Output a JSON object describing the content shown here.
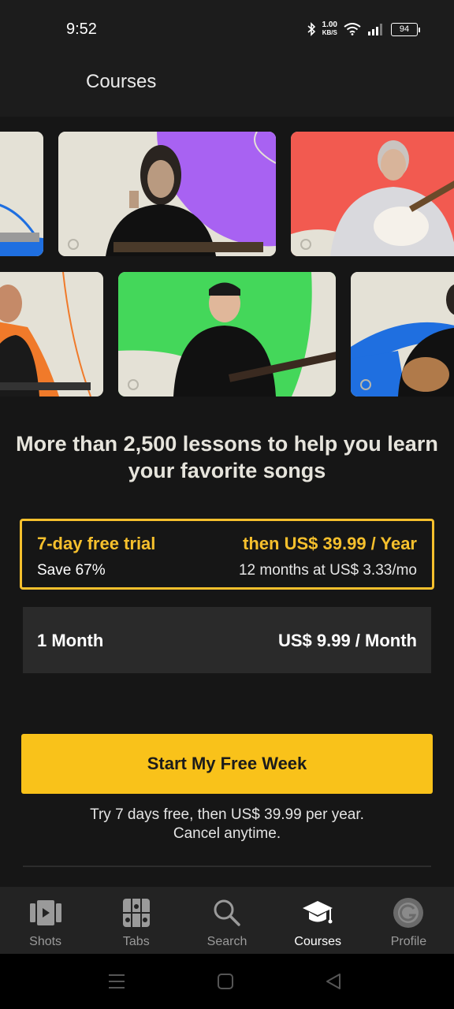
{
  "status_bar": {
    "time": "9:52",
    "speed_value": "1.00",
    "speed_unit": "KB/S",
    "battery": "94"
  },
  "header": {
    "title": "Courses"
  },
  "carousel": {
    "row1": [
      {
        "accent": "#1f6fe0",
        "bg": "#e4e1d6"
      },
      {
        "accent": "#a862f2",
        "bg": "#e4e1d6"
      },
      {
        "accent": "#f25a50",
        "bg": "#e4e1d6"
      }
    ],
    "row2": [
      {
        "accent": "#f07a2a",
        "bg": "#e4e1d6"
      },
      {
        "accent": "#44d75a",
        "bg": "#e4e1d6"
      },
      {
        "accent": "#1f6fe0",
        "bg": "#e4e1d6"
      }
    ]
  },
  "headline": "More than 2,500 lessons to help you learn your favorite songs",
  "plans": {
    "yearly": {
      "trial": "7-day free trial",
      "save": "Save 67%",
      "price": "then US$ 39.99 / Year",
      "detail": "12 months at US$ 3.33/mo"
    },
    "monthly": {
      "label": "1 Month",
      "price": "US$ 9.99 / Month"
    }
  },
  "cta": {
    "label": "Start My Free Week"
  },
  "fineprint": {
    "line1": "Try 7 days free, then US$ 39.99 per year.",
    "line2": "Cancel anytime."
  },
  "bottom_nav": [
    {
      "label": "Shots",
      "icon": "video-icon",
      "active": false
    },
    {
      "label": "Tabs",
      "icon": "tabs-grid-icon",
      "active": false
    },
    {
      "label": "Search",
      "icon": "search-icon",
      "active": false
    },
    {
      "label": "Courses",
      "icon": "graduation-cap-icon",
      "active": true
    },
    {
      "label": "Profile",
      "icon": "profile-avatar-icon",
      "active": false
    }
  ],
  "colors": {
    "accent_yellow": "#f9c21a",
    "background": "#161616"
  }
}
